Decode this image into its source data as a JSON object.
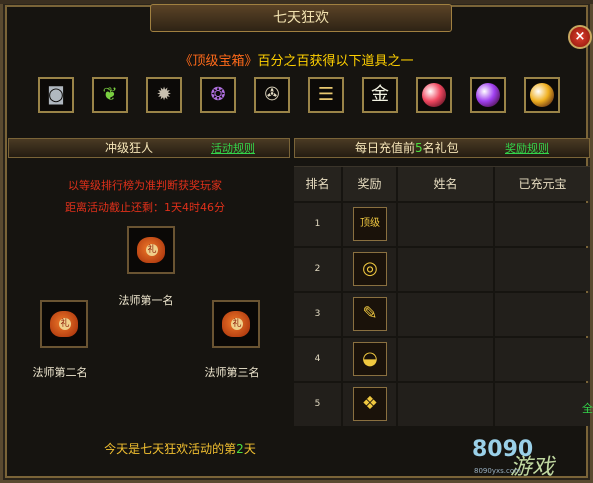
{
  "window": {
    "title": "七天狂欢",
    "close_glyph": "×"
  },
  "headline": {
    "chest": "《顶级宝箱》",
    "rest": "百分之百获得以下道具之一"
  },
  "items": [
    {
      "name": "ring-item",
      "glyph": "◙",
      "color": "#b0b8c0"
    },
    {
      "name": "wing-item",
      "glyph": "❦",
      "color": "#7ad040"
    },
    {
      "name": "spiked-armor-item",
      "glyph": "✹",
      "color": "#c8c0b0"
    },
    {
      "name": "seal-item",
      "glyph": "❂",
      "color": "#b070e0"
    },
    {
      "name": "medal-item",
      "glyph": "✇",
      "color": "#e0d8c0"
    },
    {
      "name": "scroll-item",
      "glyph": "☰",
      "color": "#e8c870"
    },
    {
      "name": "gold-token-item",
      "glyph": "金",
      "color": "#f0f0e0"
    },
    {
      "name": "red-gem-item",
      "gem": "#f04860"
    },
    {
      "name": "purple-gem-item",
      "gem": "#a040f0"
    },
    {
      "name": "yellow-gem-item",
      "gem": "#f0b020"
    }
  ],
  "left_section": {
    "title": "冲级狂人",
    "rules_link": "活动规则",
    "line1": "以等级排行榜为准判断获奖玩家",
    "line2": "距离活动截止还剩：1天4时46分",
    "bag_mark": "礼",
    "ranks": {
      "first": "法师第一名",
      "second": "法师第二名",
      "third": "法师第三名"
    }
  },
  "right_section": {
    "title_pre": "每日充值前",
    "title_num": "5",
    "title_post": "名礼包",
    "rules_link": "奖励规则",
    "columns": [
      "排名",
      "奖励",
      "姓名",
      "已充元宝"
    ],
    "rows": [
      {
        "rank": "1",
        "prize": "顶级",
        "prize_name": "top-chest-icon"
      },
      {
        "rank": "2",
        "prize": "◎",
        "prize_name": "ring-icon"
      },
      {
        "rank": "3",
        "prize": "✎",
        "prize_name": "scroll-icon"
      },
      {
        "rank": "4",
        "prize": "◒",
        "prize_name": "gold-ingot-icon"
      },
      {
        "rank": "5",
        "prize": "❖",
        "prize_name": "gold-charm-icon"
      }
    ]
  },
  "footer": {
    "pre": "今天是七天狂欢活动的第",
    "day": "2",
    "post": "天"
  },
  "watermark": {
    "logo": "8090",
    "sub": "游戏",
    "url": "8090yxs.com"
  },
  "edge_char": "全"
}
